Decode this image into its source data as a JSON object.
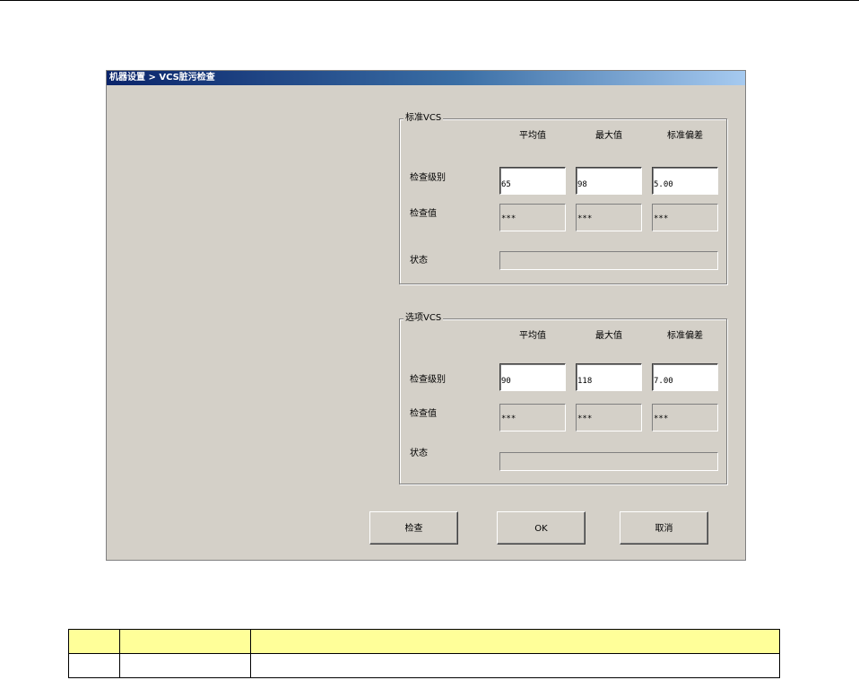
{
  "window": {
    "title": "机器设置 > VCS脏污检查"
  },
  "columns": [
    "平均值",
    "最大值",
    "标准偏差"
  ],
  "row_labels": {
    "level": "检查级别",
    "value": "检查值",
    "status": "状态"
  },
  "groups": [
    {
      "title": "标准VCS",
      "level": [
        "65",
        "98",
        "5.00"
      ],
      "value": [
        "***",
        "***",
        "***"
      ],
      "status": ""
    },
    {
      "title": "选项VCS",
      "level": [
        "90",
        "118",
        "7.00"
      ],
      "value": [
        "***",
        "***",
        "***"
      ],
      "status": ""
    }
  ],
  "buttons": {
    "check": "检查",
    "ok": "OK",
    "cancel": "取消"
  },
  "table": {
    "header": [
      "",
      "",
      ""
    ],
    "rows": [
      [
        "",
        "",
        ""
      ]
    ]
  },
  "colors": {
    "title_start": "#0a246a",
    "title_end": "#a6caf0",
    "dialog_bg": "#d4d0c8",
    "table_header": "#ffff99"
  }
}
